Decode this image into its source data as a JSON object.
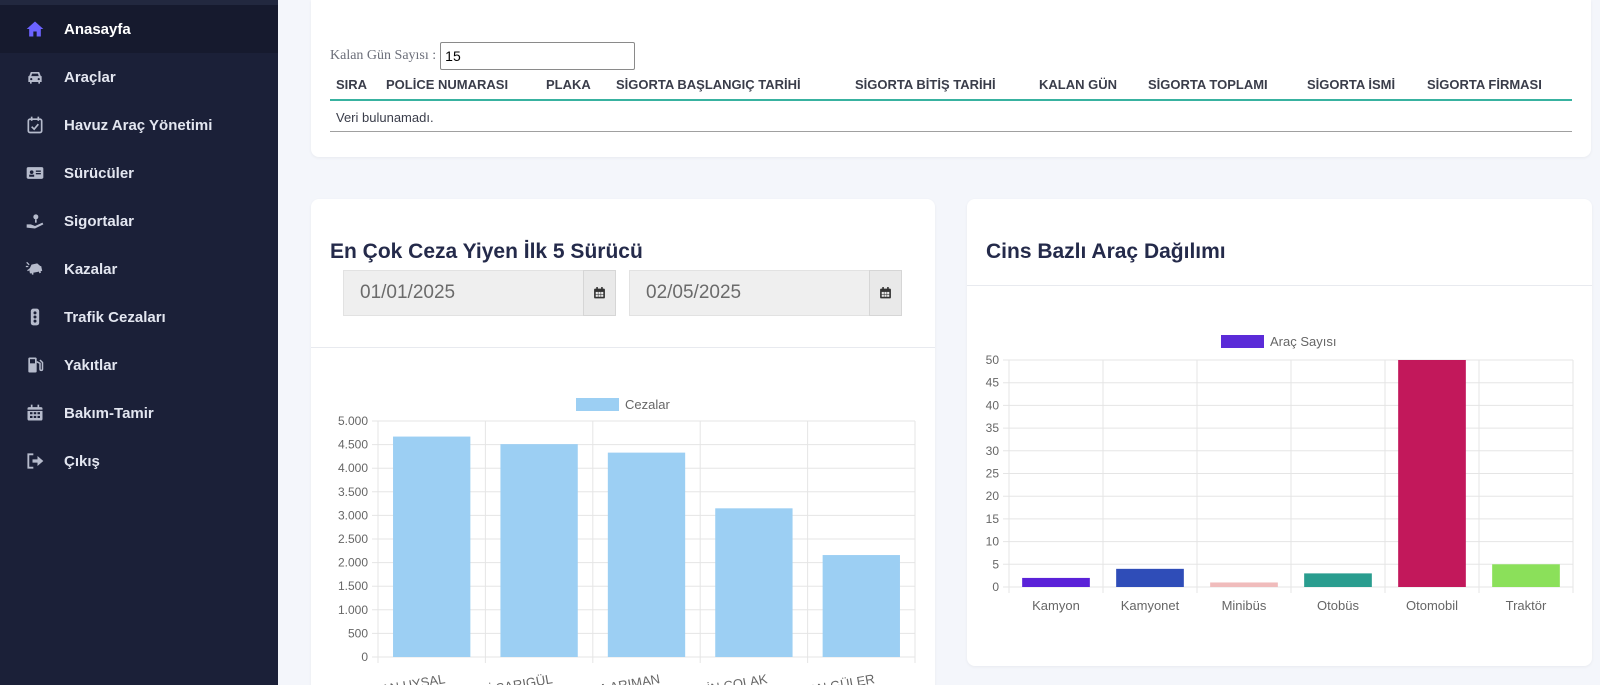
{
  "sidebar": {
    "items": [
      {
        "label": "Anasayfa",
        "icon": "home-icon",
        "active": true
      },
      {
        "label": "Araçlar",
        "icon": "car-icon"
      },
      {
        "label": "Havuz Araç Yönetimi",
        "icon": "calendar-check-icon"
      },
      {
        "label": "Sürücüler",
        "icon": "id-card-icon"
      },
      {
        "label": "Sigortalar",
        "icon": "hand-holding-icon"
      },
      {
        "label": "Kazalar",
        "icon": "car-crash-icon"
      },
      {
        "label": "Trafik Cezaları",
        "icon": "traffic-light-icon"
      },
      {
        "label": "Yakıtlar",
        "icon": "gas-pump-icon"
      },
      {
        "label": "Bakım-Tamir",
        "icon": "calendar-icon"
      },
      {
        "label": "Çıkış",
        "icon": "sign-out-icon"
      }
    ]
  },
  "insurance": {
    "days_label": "Kalan Gün Sayısı :",
    "days_value": "15",
    "columns": [
      "SIRA",
      "POLİCE NUMARASI",
      "PLAKA",
      "SİGORTA BAŞLANGIÇ TARİHİ",
      "SİGORTA BİTİŞ TARİHİ",
      "KALAN GÜN",
      "SİGORTA TOPLAMI",
      "SİGORTA İSMİ",
      "SİGORTA FİRMASI"
    ],
    "empty_text": "Veri bulunamadı."
  },
  "fines_card": {
    "title": "En Çok Ceza Yiyen İlk 5 Sürücü",
    "start_date": "01/01/2025",
    "end_date": "02/05/2025"
  },
  "vehicles_card": {
    "title": "Cins Bazlı Araç Dağılımı"
  },
  "chart_data": [
    {
      "type": "bar",
      "legend": "Cezalar",
      "categories": [
        "...AN UYSAL",
        "...İ SARIGÜL",
        "...A ARIMAN",
        "...İN ÇOLAK",
        "...AN GÜLER"
      ],
      "values": [
        4670,
        4510,
        4330,
        3150,
        2160
      ],
      "y_ticks": [
        "5.000",
        "4.500",
        "4.000",
        "3.500",
        "3.000",
        "2.500",
        "2.000",
        "1.500",
        "1.000",
        "500",
        "0"
      ],
      "ylim": [
        0,
        5000
      ],
      "color": "#9ccff3",
      "legend_position": "top-center",
      "grid": true
    },
    {
      "type": "bar",
      "legend": "Araç Sayısı",
      "legend_color": "#5b2bd8",
      "categories": [
        "Kamyon",
        "Kamyonet",
        "Minibüs",
        "Otobüs",
        "Otomobil",
        "Traktör"
      ],
      "values": [
        2,
        4,
        1,
        3,
        50,
        5
      ],
      "colors": [
        "#5a22d8",
        "#2f4db8",
        "#f0bcbc",
        "#2a9d8f",
        "#c2185b",
        "#8be05a"
      ],
      "y_ticks": [
        "50",
        "45",
        "40",
        "35",
        "30",
        "25",
        "20",
        "15",
        "10",
        "5",
        "0"
      ],
      "ylim": [
        0,
        50
      ],
      "legend_position": "top-center",
      "grid": true
    }
  ]
}
